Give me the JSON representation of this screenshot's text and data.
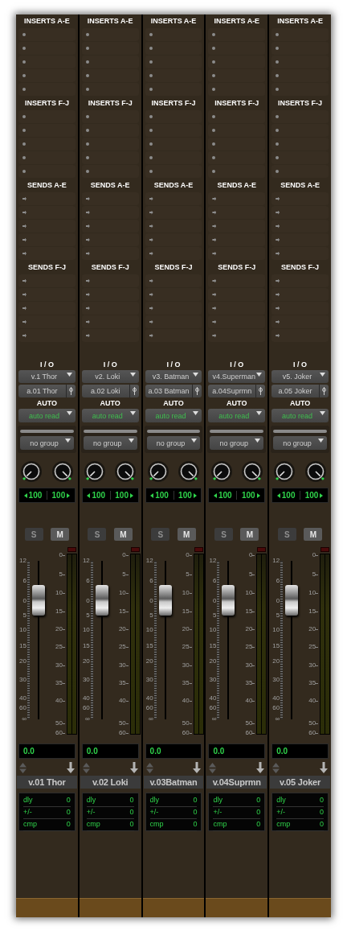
{
  "strips": [
    {
      "sections": [
        {
          "title": "INSERTS A-E",
          "kind": "insert"
        },
        {
          "title": "INSERTS F-J",
          "kind": "insert"
        },
        {
          "title": "SENDS A-E",
          "kind": "send"
        },
        {
          "title": "SENDS F-J",
          "kind": "send"
        }
      ],
      "io_label": "I / O",
      "output": "v.1 Thor",
      "input": "a.01 Thor",
      "auto_label": "AUTO",
      "automation": "auto read",
      "group": "no group",
      "pan": [
        {
          "kind": "left",
          "reading": "100"
        },
        {
          "kind": "right",
          "reading": "100"
        }
      ],
      "solo": {
        "label": "S",
        "on": false
      },
      "mute": {
        "label": "M",
        "on": false
      },
      "fader": {
        "level": 0.75,
        "scale": [
          "12",
          "6",
          "0",
          "5",
          "10",
          "15",
          "20",
          "30",
          "40",
          "60",
          "∞"
        ]
      },
      "meter": {
        "level": 0,
        "scale": [
          "0",
          "5",
          "10",
          "15",
          "20",
          "25",
          "30",
          "35",
          "40",
          "50",
          "60"
        ]
      },
      "volume": "0.0",
      "name": "v.01 Thor",
      "delay": [
        {
          "label": "dly",
          "value": "0"
        },
        {
          "label": "+/-",
          "value": "0"
        },
        {
          "label": "cmp",
          "value": "0"
        }
      ]
    },
    {
      "sections": [
        {
          "title": "INSERTS A-E",
          "kind": "insert"
        },
        {
          "title": "INSERTS F-J",
          "kind": "insert"
        },
        {
          "title": "SENDS A-E",
          "kind": "send"
        },
        {
          "title": "SENDS F-J",
          "kind": "send"
        }
      ],
      "io_label": "I / O",
      "output": "v2. Loki",
      "input": "a.02 Loki",
      "auto_label": "AUTO",
      "automation": "auto read",
      "group": "no group",
      "pan": [
        {
          "kind": "left",
          "reading": "100"
        },
        {
          "kind": "right",
          "reading": "100"
        }
      ],
      "solo": {
        "label": "S",
        "on": false
      },
      "mute": {
        "label": "M",
        "on": false
      },
      "fader": {
        "level": 0.75,
        "scale": [
          "12",
          "6",
          "0",
          "5",
          "10",
          "15",
          "20",
          "30",
          "40",
          "60",
          "∞"
        ]
      },
      "meter": {
        "level": 0,
        "scale": [
          "0",
          "5",
          "10",
          "15",
          "20",
          "25",
          "30",
          "35",
          "40",
          "50",
          "60"
        ]
      },
      "volume": "0.0",
      "name": "v.02 Loki",
      "delay": [
        {
          "label": "dly",
          "value": "0"
        },
        {
          "label": "+/-",
          "value": "0"
        },
        {
          "label": "cmp",
          "value": "0"
        }
      ]
    },
    {
      "sections": [
        {
          "title": "INSERTS A-E",
          "kind": "insert"
        },
        {
          "title": "INSERTS F-J",
          "kind": "insert"
        },
        {
          "title": "SENDS A-E",
          "kind": "send"
        },
        {
          "title": "SENDS F-J",
          "kind": "send"
        }
      ],
      "io_label": "I / O",
      "output": "v3. Batman",
      "input": "a.03 Batman",
      "auto_label": "AUTO",
      "automation": "auto read",
      "group": "no group",
      "pan": [
        {
          "kind": "left",
          "reading": "100"
        },
        {
          "kind": "right",
          "reading": "100"
        }
      ],
      "solo": {
        "label": "S",
        "on": false
      },
      "mute": {
        "label": "M",
        "on": false
      },
      "fader": {
        "level": 0.75,
        "scale": [
          "12",
          "6",
          "0",
          "5",
          "10",
          "15",
          "20",
          "30",
          "40",
          "60",
          "∞"
        ]
      },
      "meter": {
        "level": 0,
        "scale": [
          "0",
          "5",
          "10",
          "15",
          "20",
          "25",
          "30",
          "35",
          "40",
          "50",
          "60"
        ]
      },
      "volume": "0.0",
      "name": "v.03Batman",
      "delay": [
        {
          "label": "dly",
          "value": "0"
        },
        {
          "label": "+/-",
          "value": "0"
        },
        {
          "label": "cmp",
          "value": "0"
        }
      ]
    },
    {
      "sections": [
        {
          "title": "INSERTS A-E",
          "kind": "insert"
        },
        {
          "title": "INSERTS F-J",
          "kind": "insert"
        },
        {
          "title": "SENDS A-E",
          "kind": "send"
        },
        {
          "title": "SENDS F-J",
          "kind": "send"
        }
      ],
      "io_label": "I / O",
      "output": "v4.Superman",
      "input": "a.04Suprmn",
      "auto_label": "AUTO",
      "automation": "auto read",
      "group": "no group",
      "pan": [
        {
          "kind": "left",
          "reading": "100"
        },
        {
          "kind": "right",
          "reading": "100"
        }
      ],
      "solo": {
        "label": "S",
        "on": false
      },
      "mute": {
        "label": "M",
        "on": false
      },
      "fader": {
        "level": 0.75,
        "scale": [
          "12",
          "6",
          "0",
          "5",
          "10",
          "15",
          "20",
          "30",
          "40",
          "60",
          "∞"
        ]
      },
      "meter": {
        "level": 0,
        "scale": [
          "0",
          "5",
          "10",
          "15",
          "20",
          "25",
          "30",
          "35",
          "40",
          "50",
          "60"
        ]
      },
      "volume": "0.0",
      "name": "v.04Suprmn",
      "delay": [
        {
          "label": "dly",
          "value": "0"
        },
        {
          "label": "+/-",
          "value": "0"
        },
        {
          "label": "cmp",
          "value": "0"
        }
      ]
    },
    {
      "sections": [
        {
          "title": "INSERTS A-E",
          "kind": "insert"
        },
        {
          "title": "INSERTS F-J",
          "kind": "insert"
        },
        {
          "title": "SENDS A-E",
          "kind": "send"
        },
        {
          "title": "SENDS F-J",
          "kind": "send"
        }
      ],
      "io_label": "I / O",
      "output": "v5. Joker",
      "input": "a.05 Joker",
      "auto_label": "AUTO",
      "automation": "auto read",
      "group": "no group",
      "pan": [
        {
          "kind": "left",
          "reading": "100"
        },
        {
          "kind": "right",
          "reading": "100"
        }
      ],
      "solo": {
        "label": "S",
        "on": false
      },
      "mute": {
        "label": "M",
        "on": false
      },
      "fader": {
        "level": 0.75,
        "scale": [
          "12",
          "6",
          "0",
          "5",
          "10",
          "15",
          "20",
          "30",
          "40",
          "60",
          "∞"
        ]
      },
      "meter": {
        "level": 0,
        "scale": [
          "0",
          "5",
          "10",
          "15",
          "20",
          "25",
          "30",
          "35",
          "40",
          "50",
          "60"
        ]
      },
      "volume": "0.0",
      "name": "v.05 Joker",
      "delay": [
        {
          "label": "dly",
          "value": "0"
        },
        {
          "label": "+/-",
          "value": "0"
        },
        {
          "label": "cmp",
          "value": "0"
        }
      ]
    }
  ]
}
